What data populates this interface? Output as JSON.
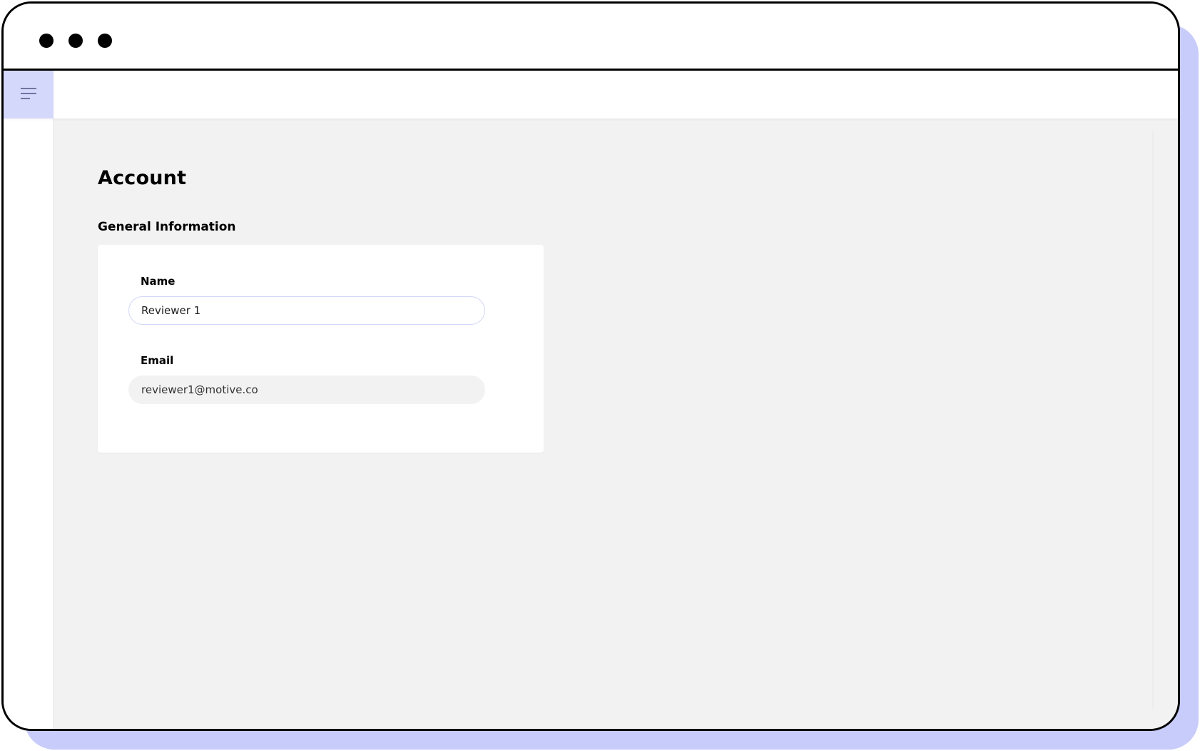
{
  "window": {
    "controls": [
      "window-dot",
      "window-dot",
      "window-dot"
    ]
  },
  "topbar": {
    "menu_icon": "hamburger-menu-icon"
  },
  "page": {
    "title": "Account",
    "section_title": "General Information"
  },
  "form": {
    "name": {
      "label": "Name",
      "value": "Reviewer 1"
    },
    "email": {
      "label": "Email",
      "value": "reviewer1@motive.co"
    }
  },
  "colors": {
    "accent": "#d4d8fb",
    "frame_shadow": "#c8ccfa",
    "content_bg": "#f2f2f2",
    "input_border": "#d3d6f6"
  }
}
